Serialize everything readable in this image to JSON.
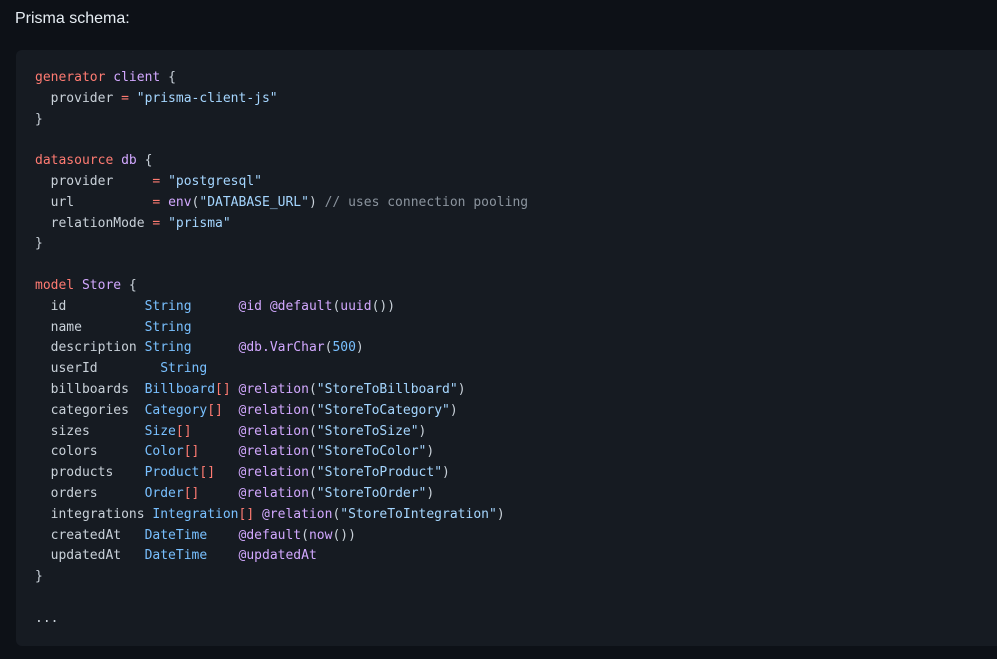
{
  "heading": "Prisma schema:",
  "code": {
    "language": "prisma",
    "lines": [
      [
        {
          "t": "generator",
          "c": "kw"
        },
        {
          "t": " "
        },
        {
          "t": "client",
          "c": "name"
        },
        {
          "t": " {"
        }
      ],
      [
        {
          "t": "  provider "
        },
        {
          "t": "=",
          "c": "op"
        },
        {
          "t": " "
        },
        {
          "t": "\"prisma-client-js\"",
          "c": "str"
        }
      ],
      [
        {
          "t": "}"
        }
      ],
      [],
      [
        {
          "t": "datasource",
          "c": "kw"
        },
        {
          "t": " "
        },
        {
          "t": "db",
          "c": "name"
        },
        {
          "t": " {"
        }
      ],
      [
        {
          "t": "  provider     "
        },
        {
          "t": "=",
          "c": "op"
        },
        {
          "t": " "
        },
        {
          "t": "\"postgresql\"",
          "c": "str"
        }
      ],
      [
        {
          "t": "  url          "
        },
        {
          "t": "=",
          "c": "op"
        },
        {
          "t": " "
        },
        {
          "t": "env",
          "c": "fn"
        },
        {
          "t": "("
        },
        {
          "t": "\"DATABASE_URL\"",
          "c": "str"
        },
        {
          "t": ") "
        },
        {
          "t": "// uses connection pooling",
          "c": "com"
        }
      ],
      [
        {
          "t": "  relationMode "
        },
        {
          "t": "=",
          "c": "op"
        },
        {
          "t": " "
        },
        {
          "t": "\"prisma\"",
          "c": "str"
        }
      ],
      [
        {
          "t": "}"
        }
      ],
      [],
      [
        {
          "t": "model",
          "c": "kw"
        },
        {
          "t": " "
        },
        {
          "t": "Store",
          "c": "name"
        },
        {
          "t": " {"
        }
      ],
      [
        {
          "t": "  id          "
        },
        {
          "t": "String",
          "c": "type"
        },
        {
          "t": "      "
        },
        {
          "t": "@id",
          "c": "attr"
        },
        {
          "t": " "
        },
        {
          "t": "@default",
          "c": "attr"
        },
        {
          "t": "("
        },
        {
          "t": "uuid",
          "c": "fn"
        },
        {
          "t": "())"
        }
      ],
      [
        {
          "t": "  name        "
        },
        {
          "t": "String",
          "c": "type"
        }
      ],
      [
        {
          "t": "  description "
        },
        {
          "t": "String",
          "c": "type"
        },
        {
          "t": "      "
        },
        {
          "t": "@db.VarChar",
          "c": "attr"
        },
        {
          "t": "("
        },
        {
          "t": "500",
          "c": "num"
        },
        {
          "t": ")"
        }
      ],
      [
        {
          "t": "  userId        "
        },
        {
          "t": "String",
          "c": "type"
        }
      ],
      [
        {
          "t": "  billboards  "
        },
        {
          "t": "Billboard",
          "c": "type"
        },
        {
          "t": "[]",
          "c": "op"
        },
        {
          "t": " "
        },
        {
          "t": "@relation",
          "c": "attr"
        },
        {
          "t": "("
        },
        {
          "t": "\"StoreToBillboard\"",
          "c": "str"
        },
        {
          "t": ")"
        }
      ],
      [
        {
          "t": "  categories  "
        },
        {
          "t": "Category",
          "c": "type"
        },
        {
          "t": "[]",
          "c": "op"
        },
        {
          "t": "  "
        },
        {
          "t": "@relation",
          "c": "attr"
        },
        {
          "t": "("
        },
        {
          "t": "\"StoreToCategory\"",
          "c": "str"
        },
        {
          "t": ")"
        }
      ],
      [
        {
          "t": "  sizes       "
        },
        {
          "t": "Size",
          "c": "type"
        },
        {
          "t": "[]",
          "c": "op"
        },
        {
          "t": "      "
        },
        {
          "t": "@relation",
          "c": "attr"
        },
        {
          "t": "("
        },
        {
          "t": "\"StoreToSize\"",
          "c": "str"
        },
        {
          "t": ")"
        }
      ],
      [
        {
          "t": "  colors      "
        },
        {
          "t": "Color",
          "c": "type"
        },
        {
          "t": "[]",
          "c": "op"
        },
        {
          "t": "     "
        },
        {
          "t": "@relation",
          "c": "attr"
        },
        {
          "t": "("
        },
        {
          "t": "\"StoreToColor\"",
          "c": "str"
        },
        {
          "t": ")"
        }
      ],
      [
        {
          "t": "  products    "
        },
        {
          "t": "Product",
          "c": "type"
        },
        {
          "t": "[]",
          "c": "op"
        },
        {
          "t": "   "
        },
        {
          "t": "@relation",
          "c": "attr"
        },
        {
          "t": "("
        },
        {
          "t": "\"StoreToProduct\"",
          "c": "str"
        },
        {
          "t": ")"
        }
      ],
      [
        {
          "t": "  orders      "
        },
        {
          "t": "Order",
          "c": "type"
        },
        {
          "t": "[]",
          "c": "op"
        },
        {
          "t": "     "
        },
        {
          "t": "@relation",
          "c": "attr"
        },
        {
          "t": "("
        },
        {
          "t": "\"StoreToOrder\"",
          "c": "str"
        },
        {
          "t": ")"
        }
      ],
      [
        {
          "t": "  integrations "
        },
        {
          "t": "Integration",
          "c": "type"
        },
        {
          "t": "[]",
          "c": "op"
        },
        {
          "t": " "
        },
        {
          "t": "@relation",
          "c": "attr"
        },
        {
          "t": "("
        },
        {
          "t": "\"StoreToIntegration\"",
          "c": "str"
        },
        {
          "t": ")"
        }
      ],
      [
        {
          "t": "  createdAt   "
        },
        {
          "t": "DateTime",
          "c": "type"
        },
        {
          "t": "    "
        },
        {
          "t": "@default",
          "c": "attr"
        },
        {
          "t": "("
        },
        {
          "t": "now",
          "c": "fn"
        },
        {
          "t": "())"
        }
      ],
      [
        {
          "t": "  updatedAt   "
        },
        {
          "t": "DateTime",
          "c": "type"
        },
        {
          "t": "    "
        },
        {
          "t": "@updatedAt",
          "c": "attr"
        }
      ],
      [
        {
          "t": "}"
        }
      ],
      [],
      [
        {
          "t": "..."
        }
      ]
    ]
  }
}
